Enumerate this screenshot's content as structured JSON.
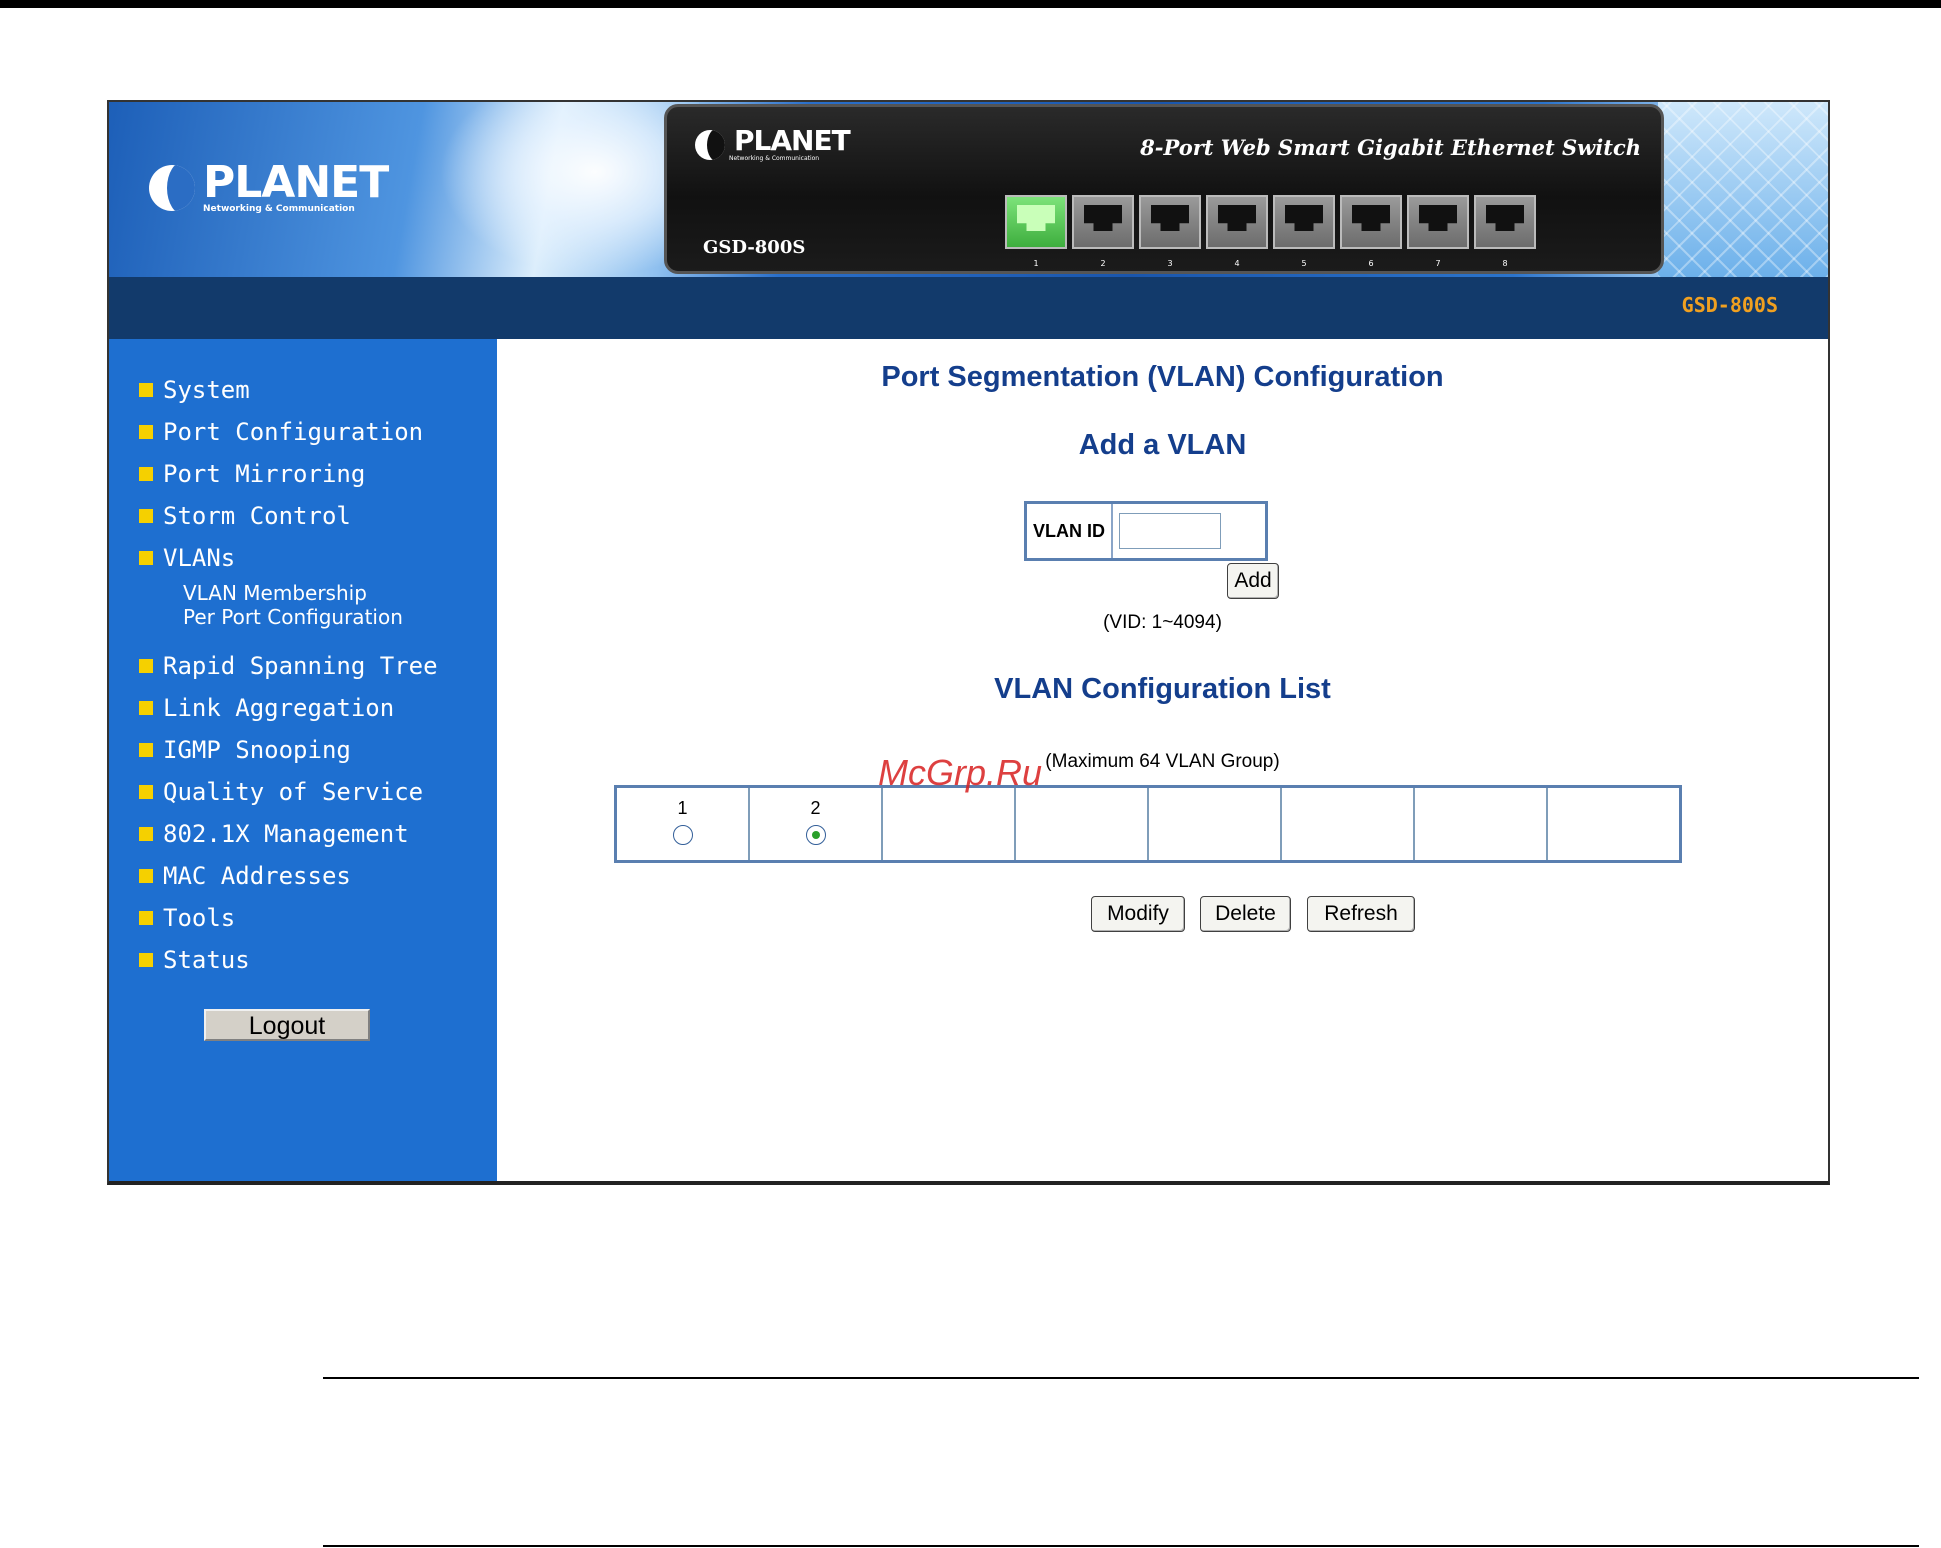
{
  "header": {
    "brand": "PLANET",
    "brand_tagline": "Networking & Communication",
    "device_brand": "PLANET",
    "device_tagline": "Networking & Communication",
    "device_title": "8-Port Web Smart Gigabit Ethernet Switch",
    "device_model": "GSD-800S",
    "port_numbers": [
      "1",
      "2",
      "3",
      "4",
      "5",
      "6",
      "7",
      "8"
    ],
    "active_port": "1",
    "model_badge": "GSD-800S"
  },
  "sidebar": {
    "items": [
      {
        "label": "System"
      },
      {
        "label": "Port Configuration"
      },
      {
        "label": "Port Mirroring"
      },
      {
        "label": "Storm Control"
      },
      {
        "label": "VLANs",
        "sub": [
          "VLAN Membership",
          "Per Port Configuration"
        ]
      },
      {
        "label": "Rapid Spanning Tree"
      },
      {
        "label": "Link Aggregation"
      },
      {
        "label": "IGMP Snooping"
      },
      {
        "label": "Quality of Service"
      },
      {
        "label": "802.1X Management"
      },
      {
        "label": "MAC Addresses"
      },
      {
        "label": "Tools"
      },
      {
        "label": "Status"
      }
    ],
    "logout_label": "Logout"
  },
  "main": {
    "title": "Port Segmentation (VLAN) Configuration",
    "add_heading": "Add a VLAN",
    "vlan_id_label": "VLAN ID",
    "vlan_id_value": "",
    "add_button": "Add",
    "vid_range": "(VID: 1~4094)",
    "list_heading": "VLAN Configuration List",
    "list_note": "(Maximum 64 VLAN Group)",
    "vlans": [
      {
        "id": "1",
        "selected": false
      },
      {
        "id": "2",
        "selected": true
      },
      {
        "id": "",
        "selected": null
      },
      {
        "id": "",
        "selected": null
      },
      {
        "id": "",
        "selected": null
      },
      {
        "id": "",
        "selected": null
      },
      {
        "id": "",
        "selected": null
      },
      {
        "id": "",
        "selected": null
      }
    ],
    "buttons": {
      "modify": "Modify",
      "delete": "Delete",
      "refresh": "Refresh"
    }
  },
  "watermark": "McGrp.Ru",
  "colors": {
    "sidebar_bg": "#1e6fd0",
    "navbar_bg": "#123a6b",
    "heading": "#143e8c",
    "bullet": "#f5d000",
    "badge": "#f0a020"
  }
}
